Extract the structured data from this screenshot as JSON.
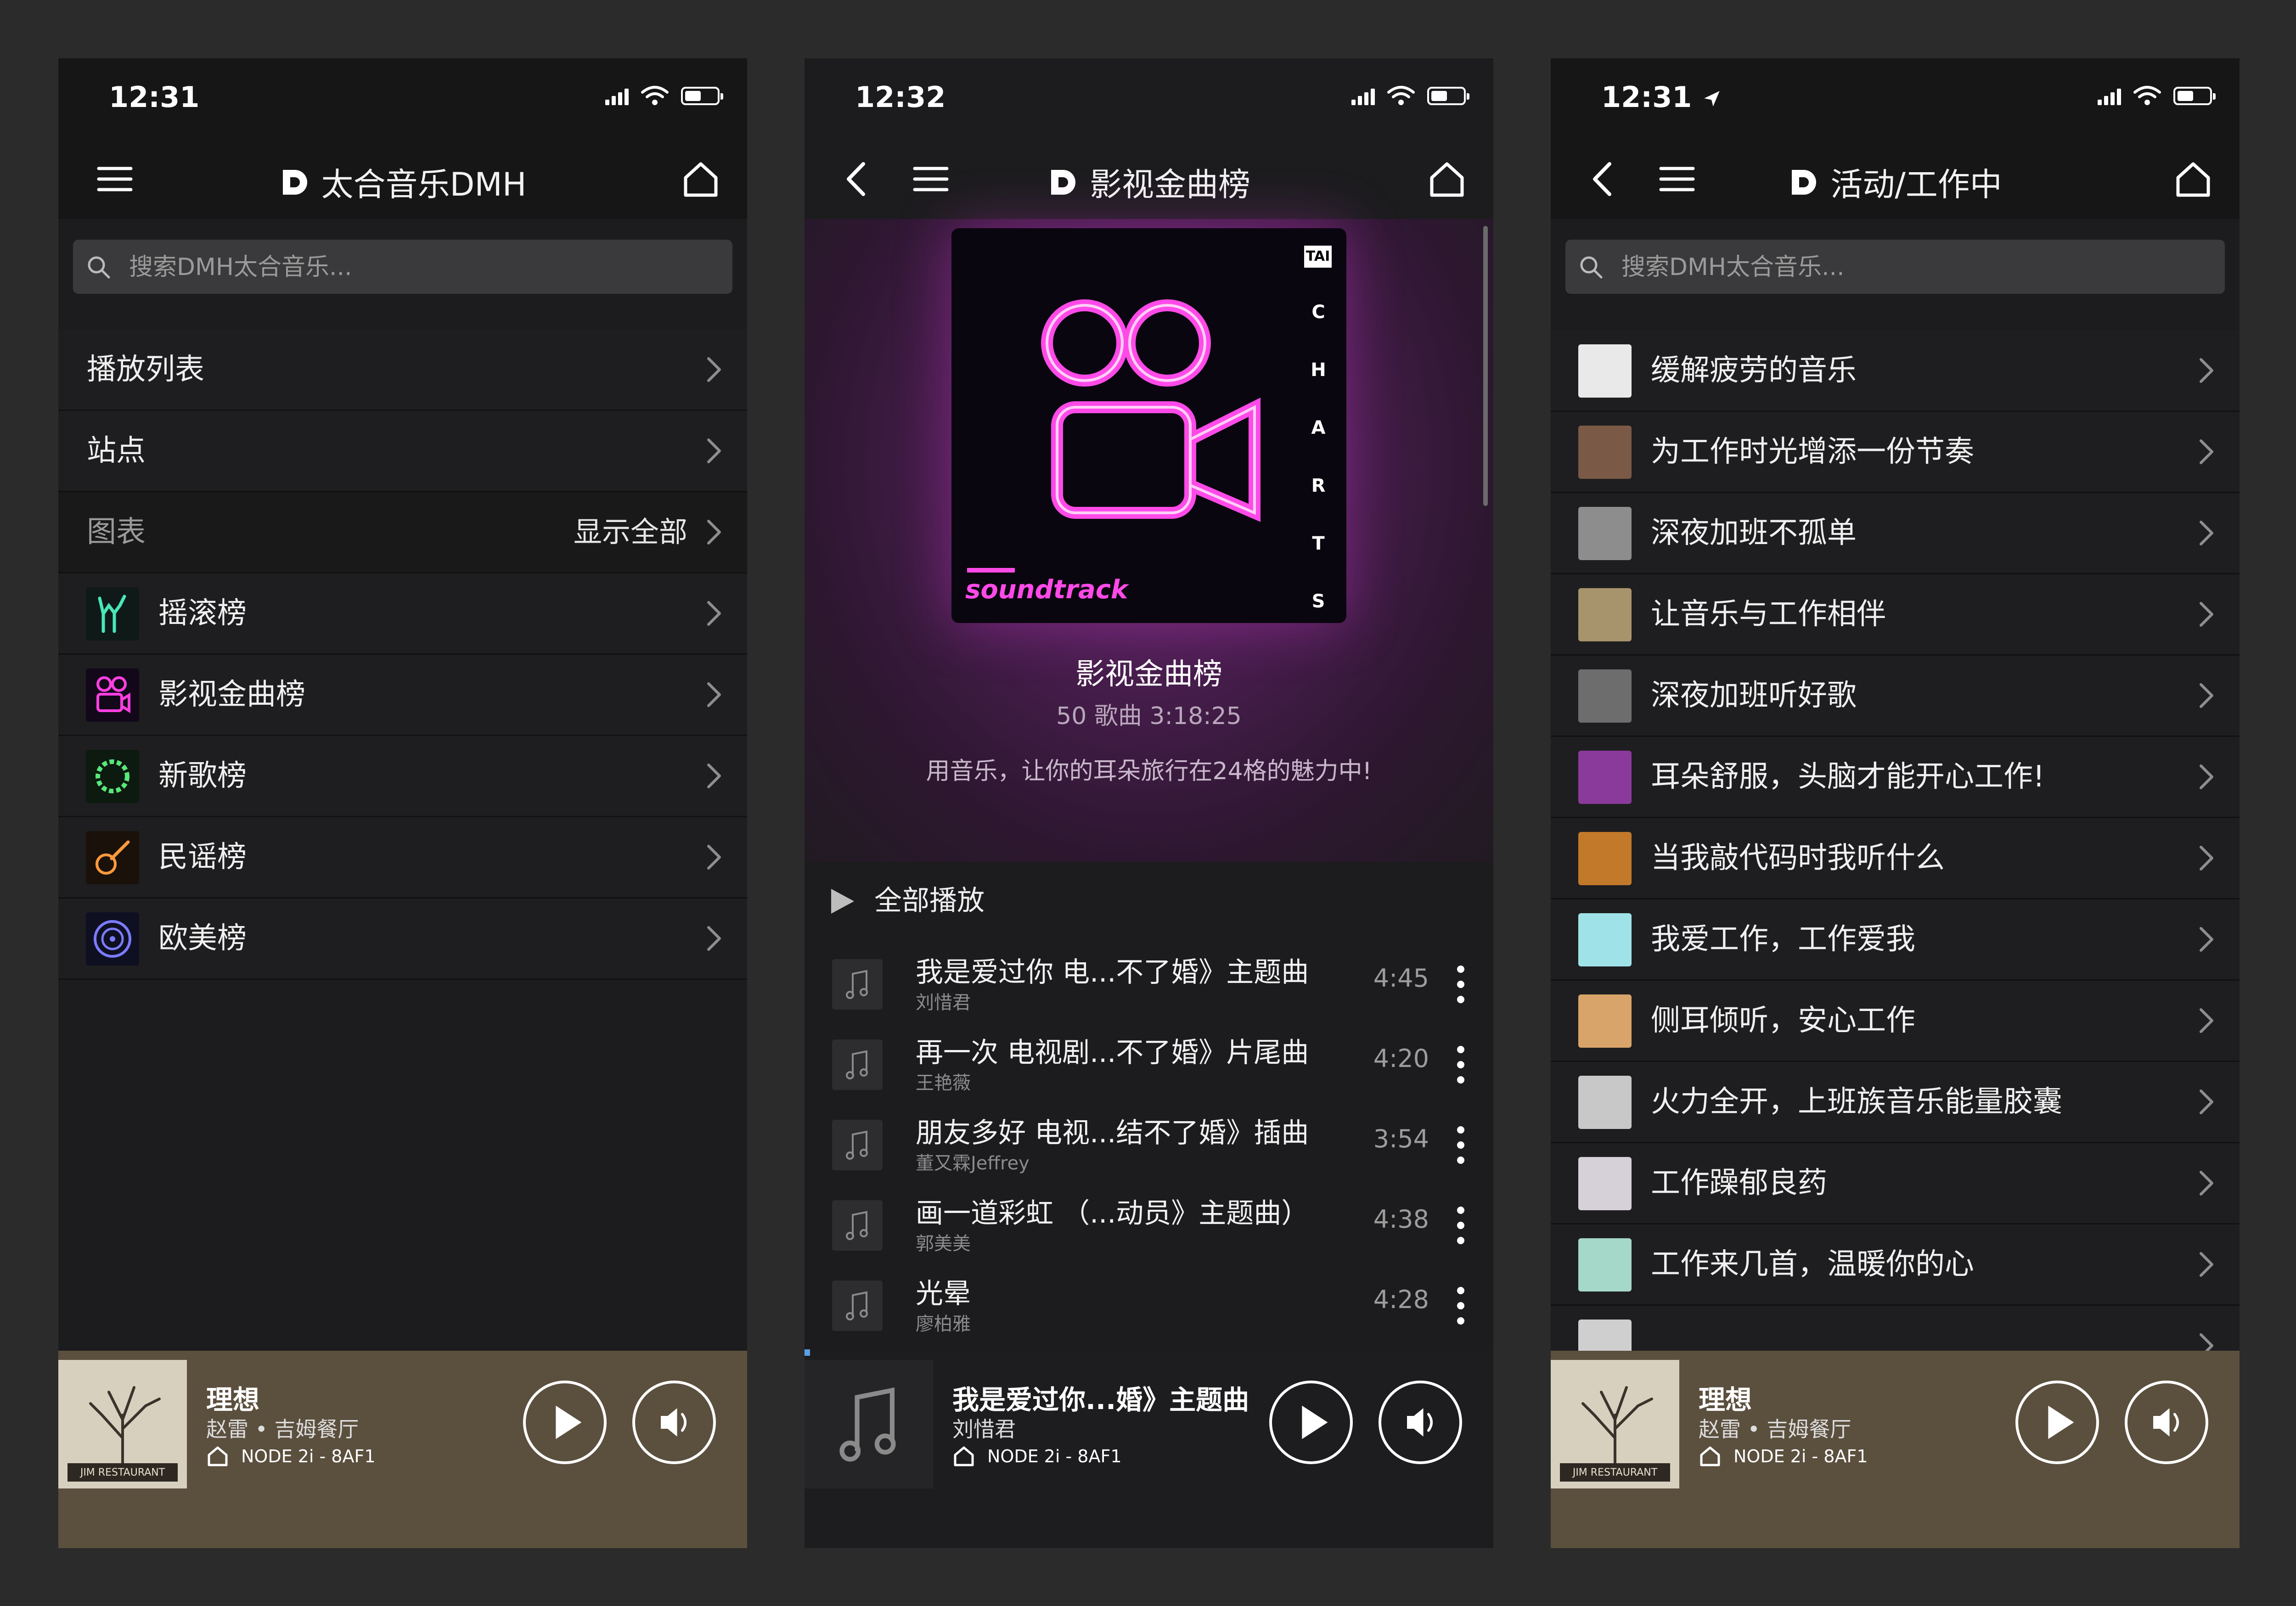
{
  "screens": [
    {
      "status": {
        "time": "12:31"
      },
      "nav": {
        "title": "太合音乐DMH"
      },
      "search": {
        "placeholder": "搜索DMH太合音乐..."
      },
      "menu": [
        {
          "label": "播放列表"
        },
        {
          "label": "站点"
        }
      ],
      "charts_section": {
        "label": "图表",
        "show_all": "显示全部"
      },
      "charts": [
        {
          "label": "摇滚榜",
          "icon": "rock-hand-icon",
          "color": "#49e6b8"
        },
        {
          "label": "影视金曲榜",
          "icon": "movie-camera-icon",
          "color": "#ff3fe0"
        },
        {
          "label": "新歌榜",
          "icon": "wreath-icon",
          "color": "#58e87a"
        },
        {
          "label": "民谣榜",
          "icon": "guitar-icon",
          "color": "#ff9a3c"
        },
        {
          "label": "欧美榜",
          "icon": "vinyl-icon",
          "color": "#7a7cff"
        }
      ],
      "player": {
        "title": "理想",
        "artist": "赵雷 • 吉姆餐厅",
        "node": "NODE 2i - 8AF1"
      }
    },
    {
      "status": {
        "time": "12:32"
      },
      "nav": {
        "title": "影视金曲榜"
      },
      "hero": {
        "title": "影视金曲榜",
        "meta": "50 歌曲   3:18:25",
        "description": "用音乐，让你的耳朵旅行在24格的魅力中!",
        "cover_label": "soundtrack",
        "cover_side": "CHARTS",
        "cover_badge": "TAI"
      },
      "play_all": "全部播放",
      "tracks": [
        {
          "title": "我是爱过你 电...不了婚》主题曲",
          "artist": "刘惜君",
          "duration": "4:45"
        },
        {
          "title": "再一次 电视剧...不了婚》片尾曲",
          "artist": "王艳薇",
          "duration": "4:20"
        },
        {
          "title": "朋友多好 电视...结不了婚》插曲",
          "artist": "董又霖Jeffrey",
          "duration": "3:54"
        },
        {
          "title": "画一道彩虹 （...动员》主题曲）",
          "artist": "郭美美",
          "duration": "4:38"
        },
        {
          "title": "光晕",
          "artist": "廖柏雅",
          "duration": "4:28"
        }
      ],
      "player": {
        "title": "我是爱过你...婚》主题曲",
        "artist": "刘惜君",
        "node": "NODE 2i - 8AF1"
      }
    },
    {
      "status": {
        "time": "12:31"
      },
      "nav": {
        "title": "活动/工作中"
      },
      "search": {
        "placeholder": "搜索DMH太合音乐..."
      },
      "playlists": [
        {
          "label": "缓解疲劳的音乐",
          "color": "#e9e9e9"
        },
        {
          "label": "为工作时光增添一份节奏",
          "color": "#7a5a46"
        },
        {
          "label": "深夜加班不孤单",
          "color": "#8d8d8d"
        },
        {
          "label": "让音乐与工作相伴",
          "color": "#a8946c"
        },
        {
          "label": "深夜加班听好歌",
          "color": "#6d6d6d"
        },
        {
          "label": "耳朵舒服，头脑才能开心工作!",
          "color": "#8a3a9a"
        },
        {
          "label": "当我敲代码时我听什么",
          "color": "#c27a2a"
        },
        {
          "label": "我爱工作，工作爱我",
          "color": "#9fe3e8"
        },
        {
          "label": "侧耳倾听，安心工作",
          "color": "#d9a46a"
        },
        {
          "label": "火力全开，上班族音乐能量胶囊",
          "color": "#c8c8c8"
        },
        {
          "label": "工作躁郁良药",
          "color": "#d6d0d8"
        },
        {
          "label": "工作来几首，温暖你的心",
          "color": "#a5d8c8"
        },
        {
          "label": "",
          "color": "#cfcfcf"
        }
      ],
      "player": {
        "title": "理想",
        "artist": "赵雷 • 吉姆餐厅",
        "node": "NODE 2i - 8AF1"
      }
    }
  ]
}
